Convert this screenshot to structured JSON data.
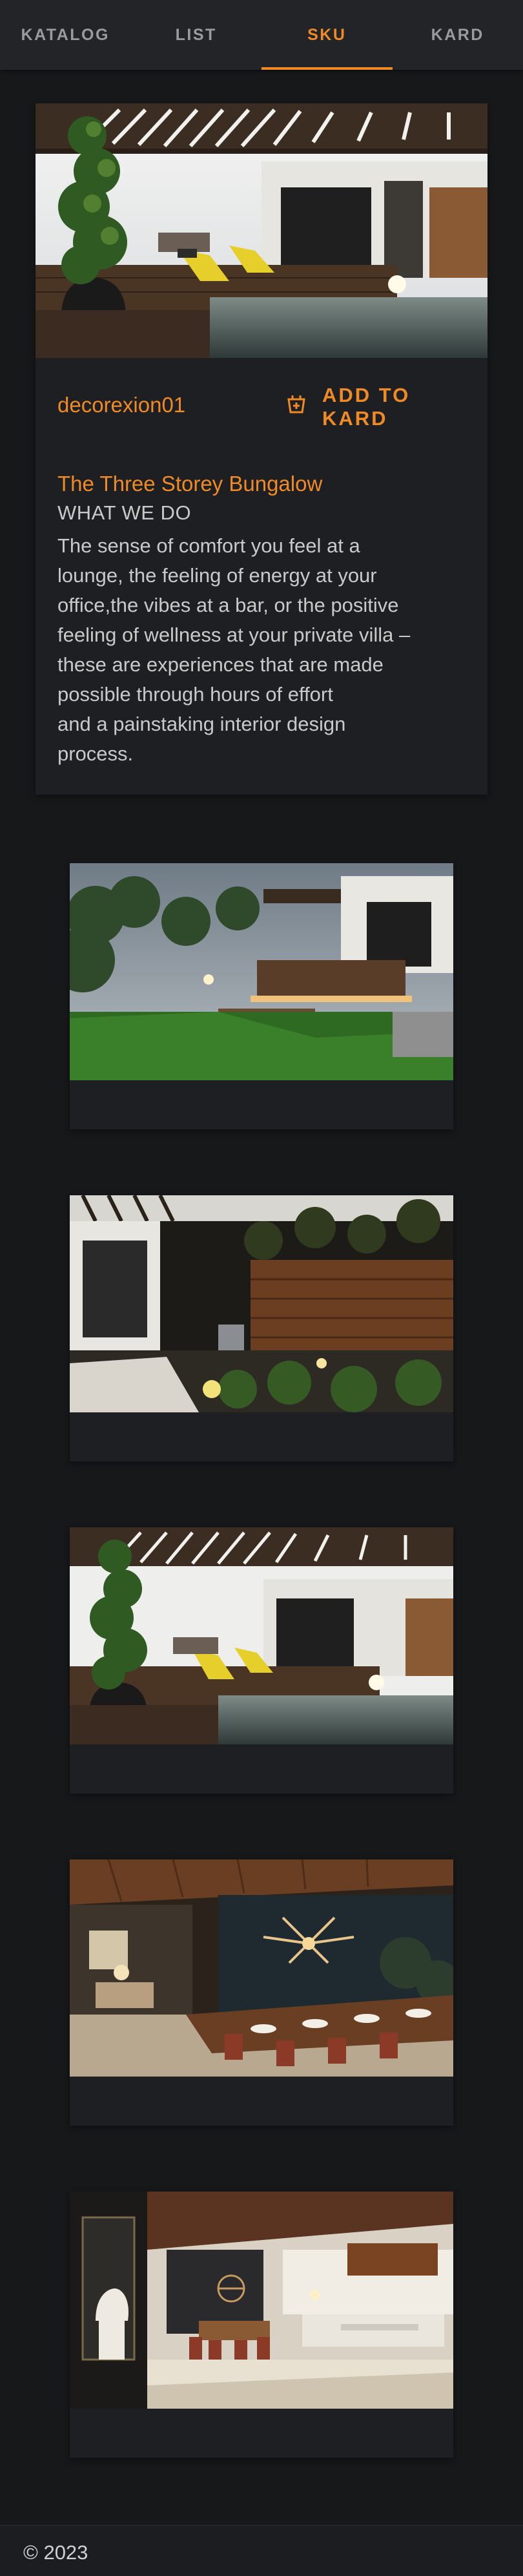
{
  "tabs": [
    {
      "label": "KATALOG",
      "active": false
    },
    {
      "label": "LIST",
      "active": false
    },
    {
      "label": "SKU",
      "active": true
    },
    {
      "label": "KARD",
      "active": false
    }
  ],
  "product": {
    "user": "decorexion01",
    "add_label": "ADD TO KARD",
    "add_icon": "cart-add-icon",
    "title": "The Three Storey Bungalow",
    "section": "WHAT WE DO",
    "description_lines": [
      "The sense of comfort you feel at a",
      "lounge, the feeling of energy at your",
      "office,the vibes at a bar, or the positive",
      "feeling of wellness at your private villa –",
      "these are experiences that are made",
      "possible through hours of effort",
      "and a painstaking interior design",
      "process."
    ]
  },
  "gallery": [
    {
      "scene": "terrace-garden-night"
    },
    {
      "scene": "courtyard-lounge"
    },
    {
      "scene": "pool-deck-pergola"
    },
    {
      "scene": "dining-room-chandelier"
    },
    {
      "scene": "dining-kitchen-interior"
    }
  ],
  "footer": {
    "copyright": "© 2023"
  },
  "colors": {
    "accent": "#f08a24",
    "background": "#17181a",
    "card": "#1e1f22",
    "tabbar": "#232427"
  }
}
